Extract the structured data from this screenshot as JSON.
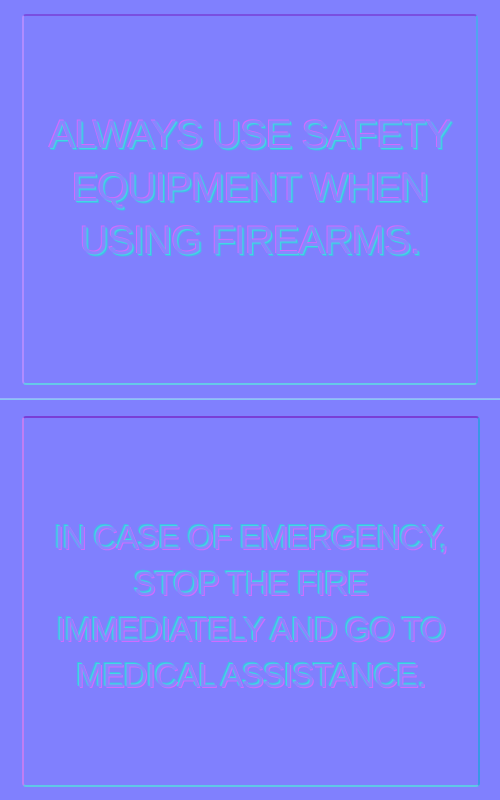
{
  "panels": {
    "top": {
      "text": "ALWAYS USE SAFETY EQUIPMENT WHEN USING FIREARMS."
    },
    "bottom": {
      "text": "IN CASE OF EMERGENCY, STOP THE FIRE IMMEDIATELY AND GO TO MEDICAL ASSISTANCE."
    }
  },
  "colors": {
    "background": "#8080fe",
    "raised_highlight": "#d06cff",
    "raised_shadow": "#44d6e6",
    "divider": "#9fa6ff"
  }
}
